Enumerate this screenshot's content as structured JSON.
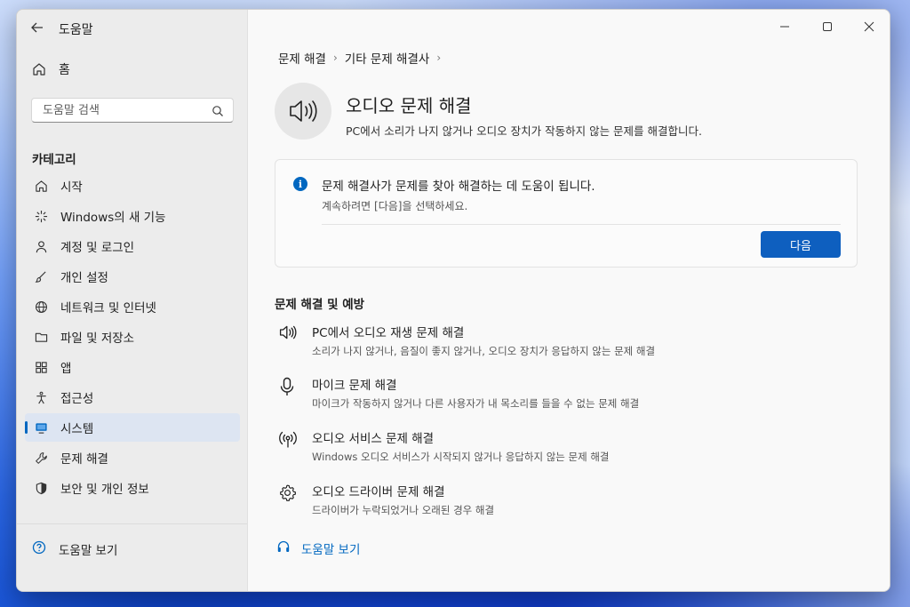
{
  "app": {
    "title": "도움말"
  },
  "sidebar": {
    "home": "홈",
    "search_placeholder": "도움말 검색",
    "category_title": "카테고리",
    "items": [
      {
        "label": "시작"
      },
      {
        "label": "Windows의 새 기능"
      },
      {
        "label": "계정 및 로그인"
      },
      {
        "label": "개인 설정"
      },
      {
        "label": "네트워크 및 인터넷"
      },
      {
        "label": "파일 및 저장소"
      },
      {
        "label": "앱"
      },
      {
        "label": "접근성"
      },
      {
        "label": "시스템"
      },
      {
        "label": "문제 해결"
      },
      {
        "label": "보안 및 개인 정보"
      }
    ],
    "help": "도움말 보기"
  },
  "breadcrumb": [
    "문제 해결",
    "기타 문제 해결사"
  ],
  "hero": {
    "title": "오디오 문제 해결",
    "subtitle": "PC에서 소리가 나지 않거나 오디오 장치가 작동하지 않는 문제를 해결합니다."
  },
  "card": {
    "title": "문제 해결사가 문제를 찾아 해결하는 데 도움이 됩니다.",
    "subtitle": "계속하려면 [다음]을 선택하세요.",
    "next": "다음"
  },
  "section": {
    "title": "문제 해결 및 예방",
    "items": [
      {
        "title": "PC에서 오디오 재생 문제 해결",
        "desc": "소리가 나지 않거나, 음질이 좋지 않거나, 오디오 장치가 응답하지 않는 문제 해결",
        "icon": "speaker-icon"
      },
      {
        "title": "마이크 문제 해결",
        "desc": "마이크가 작동하지 않거나 다른 사용자가 내 목소리를 들을 수 없는 문제 해결",
        "icon": "microphone-icon"
      },
      {
        "title": "오디오 서비스 문제 해결",
        "desc": "Windows 오디오 서비스가 시작되지 않거나 응답하지 않는 문제 해결",
        "icon": "broadcast-icon"
      },
      {
        "title": "오디오 드라이버 문제 해결",
        "desc": "드라이버가 누락되었거나 오래된 경우 해결",
        "icon": "gear-icon"
      }
    ]
  },
  "help_link": "도움말 보기",
  "colors": {
    "accent": "#0067c0",
    "button": "#0e5fbf"
  }
}
